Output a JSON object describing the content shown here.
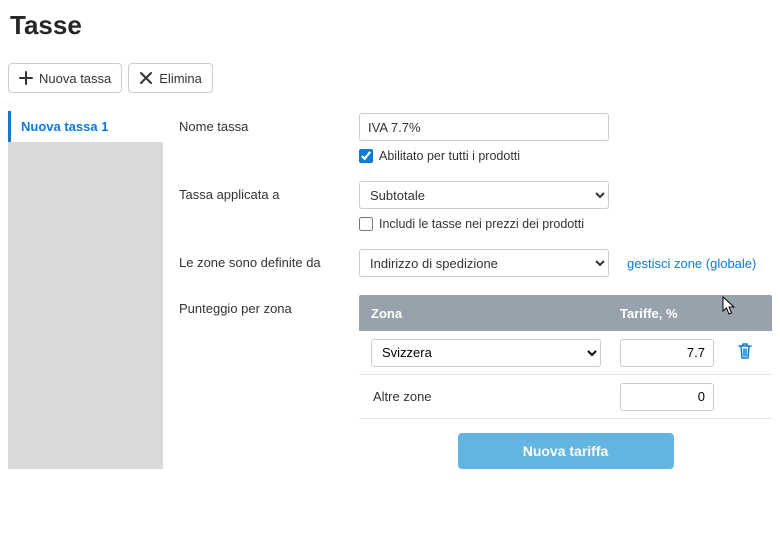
{
  "page": {
    "title": "Tasse"
  },
  "toolbar": {
    "new_label": "Nuova tassa",
    "delete_label": "Elimina"
  },
  "sidebar": {
    "items": [
      {
        "label": "Nuova tassa 1"
      }
    ]
  },
  "form": {
    "name_label": "Nome tassa",
    "name_value": "IVA 7.7%",
    "enabled_checked": true,
    "enabled_label": "Abilitato per tutti i prodotti",
    "applied_label": "Tassa applicata a",
    "applied_value": "Subtotale",
    "include_prices_checked": false,
    "include_prices_label": "Includi le tasse nei prezzi dei prodotti",
    "zones_defined_label": "Le zone sono definite da",
    "zones_defined_value": "Indirizzo di spedizione",
    "manage_zones_link": "gestisci zone (globale)",
    "rates_label": "Punteggio per zona",
    "rates_header_zone": "Zona",
    "rates_header_rate": "Tariffe, %",
    "rates": [
      {
        "zone": "Svizzera",
        "rate": "7.7",
        "editable_zone": true,
        "deletable": true
      },
      {
        "zone": "Altre zone",
        "rate": "0",
        "editable_zone": false,
        "deletable": false
      }
    ],
    "new_rate_label": "Nuova tariffa"
  }
}
